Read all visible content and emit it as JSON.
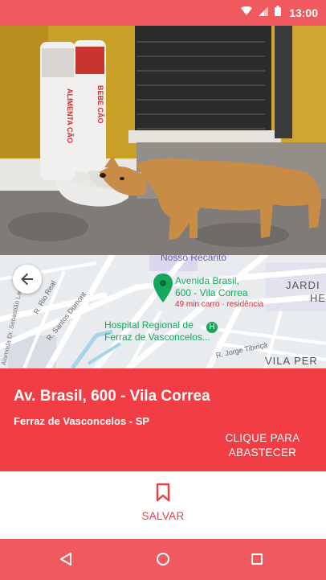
{
  "status_bar": {
    "time": "13:00",
    "icons": [
      "wifi-icon",
      "signal-icon",
      "battery-icon"
    ]
  },
  "photo": {
    "icon": "dog-feeder-photo",
    "feeder_labels": [
      "ALIMENTA CÃO",
      "BEBE CÃO"
    ]
  },
  "map": {
    "labels": {
      "nosso_recanto": "Nosso Recanto",
      "pin_line1": "Avenida Brasil,",
      "pin_line2": "600 - Vila Correa",
      "travel": "49 min carro · residência",
      "hospital1": "Hospital Regional de",
      "hospital2": "Ferraz de Vasconcelos...",
      "santos_dumont": "R. Santos Dumont",
      "rio_real": "R. Rio Real",
      "jorge": "R. Jorge Tibiriçá",
      "jardim": "JARDI",
      "he": "HE",
      "vila_pera": "VILA PER",
      "side_street": "Alameda Dr. Sebastião Lago"
    }
  },
  "info": {
    "address": "Av. Brasil, 600 - Vila Correa",
    "city": "Ferraz de Vasconcelos - SP",
    "cta_line1": "CLIQUE PARA",
    "cta_line2": "ABASTECER"
  },
  "save": {
    "label": "SALVAR"
  },
  "nav": {
    "icons": [
      "back-triangle-icon",
      "home-circle-icon",
      "recents-square-icon"
    ]
  },
  "colors": {
    "primary": "#f03e44",
    "bar": "#f05a5f",
    "map_green": "#14a85c"
  }
}
